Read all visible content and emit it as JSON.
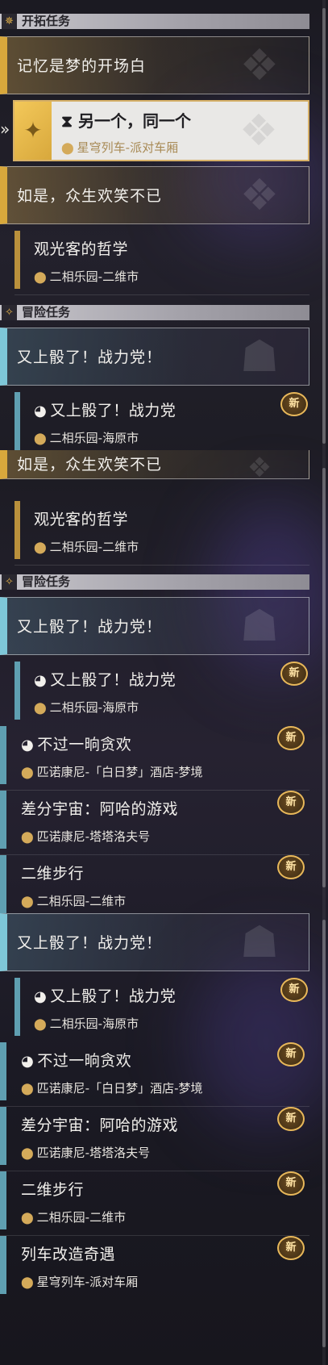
{
  "categories": {
    "trailblaze": "开拓任务",
    "adventure": "冒险任务"
  },
  "icons": {
    "trailblaze_cat": "compass-star-icon",
    "adventure_cat": "sparkle-icon",
    "location": "map-pin-icon",
    "quest_item": "panda-head-icon",
    "selected_quest": "hourglass-icon",
    "new_badge": "new-badge-icon"
  },
  "colors": {
    "gold": "#d8a83c",
    "blue": "#7ec7d8"
  },
  "quests": {
    "dream_opening": "记忆是梦的开场白",
    "another_same": "另一个，同一个",
    "another_same_loc": "星穹列车-派对车厢",
    "everyone_laughs": "如是，众生欢笑不已",
    "tourist_philosophy": "观光客的哲学",
    "tourist_loc": "二相乐园-二维市",
    "fight_group": "又上骰了！战力党！",
    "fight_item": "又上骰了！战力党",
    "fight_loc": "二相乐园-海原市",
    "moment_joy": "不过一晌贪欢",
    "moment_loc": "匹诺康尼-「白日梦」酒店-梦境",
    "aha_game": "差分宇宙：阿哈的游戏",
    "aha_loc": "匹诺康尼-塔塔洛夫号",
    "two_d_walk": "二维步行",
    "two_d_loc": "二相乐园-二维市",
    "train_mod": "列车改造奇遇",
    "train_loc": "星穹列车-派对车厢"
  },
  "badge_text": "新"
}
